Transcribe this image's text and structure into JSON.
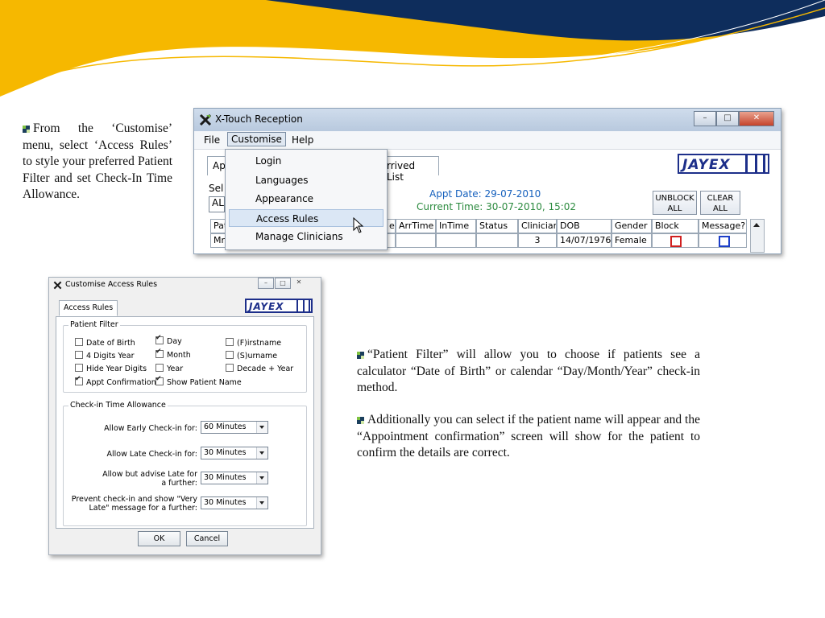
{
  "colors": {
    "navy": "#0e2d5c",
    "gold": "#f6b800",
    "jayex_blue": "#1d2f8a"
  },
  "left_text": "From the ‘Customise’ menu, select ‘Access Rules’ to style your preferred Patient Filter and set Check-In Time Allowance.",
  "right_text_1": "“Patient Filter” will allow you to choose if patients see a calculator “Date of Birth” or calendar “Day/Month/Year” check-in method.",
  "right_text_2": "Additionally you can  select if the patient name will appear and the “Appointment confirmation” screen will show for the patient to confirm the details are correct.",
  "reception": {
    "title": "X-Touch Reception",
    "menu": [
      "File",
      "Customise",
      "Help"
    ],
    "tab_left": "Ap",
    "tab_arrived": "rrived List",
    "sel_label": "Sel",
    "sel_value": "AL",
    "logo": "JAYEX",
    "appt_date": "Appt Date: 29-07-2010",
    "current_time": "Current Time: 30-07-2010, 15:02",
    "unblock": [
      "UNBLOCK",
      "ALL"
    ],
    "clear": [
      "CLEAR",
      "ALL"
    ],
    "headers": [
      "Pat",
      "e",
      "ArrTime",
      "InTime",
      "Status",
      "Clinician",
      "DOB",
      "Gender",
      "Block",
      "Message?"
    ],
    "row": [
      "Mrs",
      "",
      "",
      "",
      "",
      "3",
      "14/07/1976",
      "Female"
    ],
    "dropdown": [
      "Login",
      "Languages",
      "Appearance",
      "Access Rules",
      "Manage Clinicians"
    ]
  },
  "dialog": {
    "title": "Customise Access Rules",
    "tab": "Access Rules",
    "logo": "JAYEX",
    "patient_filter_label": "Patient Filter",
    "checkboxes": [
      {
        "label": "Date of Birth",
        "checked": false
      },
      {
        "label": "Day",
        "checked": true
      },
      {
        "label": "(F)irstname",
        "checked": false
      },
      {
        "label": "4 Digits Year",
        "checked": false
      },
      {
        "label": "Month",
        "checked": true
      },
      {
        "label": "(S)urname",
        "checked": false
      },
      {
        "label": "Hide Year Digits",
        "checked": false
      },
      {
        "label": "Year",
        "checked": false
      },
      {
        "label": "Decade + Year",
        "checked": false
      },
      {
        "label": "Appt Confirmation",
        "checked": true
      },
      {
        "label": "Show Patient Name",
        "checked": true
      }
    ],
    "checkin_label": "Check-in Time Allowance",
    "rows": [
      {
        "label": "Allow Early Check-in for:",
        "value": "60 Minutes"
      },
      {
        "label": "Allow Late Check-in for:",
        "value": "30 Minutes"
      },
      {
        "label": "Allow but advise Late for a further:",
        "value": "30 Minutes"
      },
      {
        "label": "Prevent check-in and show \"Very Late\" message for a further:",
        "value": "30 Minutes"
      }
    ],
    "ok": "OK",
    "cancel": "Cancel"
  }
}
